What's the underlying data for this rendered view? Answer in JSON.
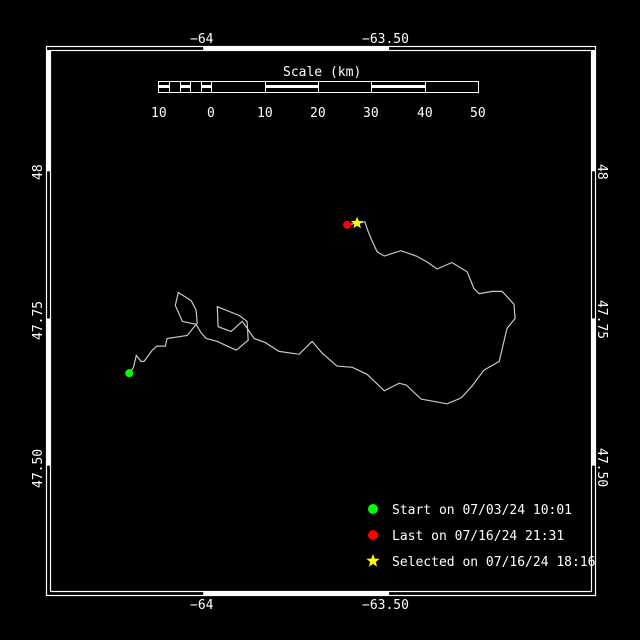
{
  "map": {
    "lon_ticks": [
      {
        "value": -64,
        "label": "−64"
      },
      {
        "value": -63.5,
        "label": "−63.50"
      }
    ],
    "lat_ticks": [
      {
        "value": 48,
        "label": "48"
      },
      {
        "value": 47.75,
        "label": "47.75"
      },
      {
        "value": 47.5,
        "label": "47.50"
      }
    ],
    "lon_range": [
      -64.412,
      -62.957
    ],
    "lat_range": [
      48.206,
      47.287
    ],
    "track_color": "#c8c8c8",
    "track": {
      "lon": [
        -64.199,
        -64.188,
        -64.18,
        -64.167,
        -64.159,
        -64.137,
        -64.124,
        -64.102,
        -64.097,
        -64.043,
        -64.016,
        -64.019,
        -64.032,
        -64.067,
        -64.075,
        -64.056,
        -64.019,
        -64.005,
        -63.992,
        -63.962,
        -63.911,
        -63.879,
        -63.882,
        -63.903,
        -63.962,
        -63.96,
        -63.925,
        -63.895,
        -63.876,
        -63.863,
        -63.833,
        -63.796,
        -63.742,
        -63.707,
        -63.68,
        -63.64,
        -63.599,
        -63.559,
        -63.513,
        -63.473,
        -63.454,
        -63.414,
        -63.344,
        -63.306,
        -63.277,
        -63.245,
        -63.204,
        -63.183,
        -63.161,
        -63.164,
        -63.196,
        -63.223,
        -63.258,
        -63.272,
        -63.29,
        -63.331,
        -63.371,
        -63.398,
        -63.427,
        -63.468,
        -63.513,
        -63.532,
        -63.546,
        -63.556,
        -63.565,
        -63.586,
        -63.613
      ],
      "lat": [
        47.657,
        47.666,
        47.687,
        47.677,
        47.677,
        47.696,
        47.703,
        47.703,
        47.716,
        47.721,
        47.742,
        47.764,
        47.78,
        47.794,
        47.772,
        47.745,
        47.74,
        47.725,
        47.716,
        47.711,
        47.696,
        47.713,
        47.745,
        47.755,
        47.77,
        47.736,
        47.728,
        47.745,
        47.728,
        47.716,
        47.709,
        47.694,
        47.689,
        47.711,
        47.691,
        47.669,
        47.667,
        47.655,
        47.627,
        47.64,
        47.637,
        47.613,
        47.605,
        47.615,
        47.635,
        47.662,
        47.677,
        47.733,
        47.75,
        47.774,
        47.796,
        47.796,
        47.792,
        47.801,
        47.829,
        47.845,
        47.834,
        47.846,
        47.856,
        47.865,
        47.856,
        47.863,
        47.882,
        47.897,
        47.914,
        47.912,
        47.909
      ]
    },
    "start": {
      "lon": -64.199,
      "lat": 47.657,
      "color": "#00ff00"
    },
    "last": {
      "lon": -63.613,
      "lat": 47.909,
      "color": "#ff0000"
    },
    "selected": {
      "lon": -63.586,
      "lat": 47.912,
      "color": "#ffff00"
    }
  },
  "scale": {
    "title": "Scale (km)",
    "labels": [
      "10",
      "0",
      "10",
      "20",
      "30",
      "40",
      "50"
    ]
  },
  "legend": [
    {
      "icon": "green-circle-icon",
      "label": "Start on 07/03/24 10:01"
    },
    {
      "icon": "red-circle-icon",
      "label": "Last on 07/16/24 21:31"
    },
    {
      "icon": "yellow-star-icon",
      "label": "Selected on 07/16/24 18:16"
    }
  ]
}
